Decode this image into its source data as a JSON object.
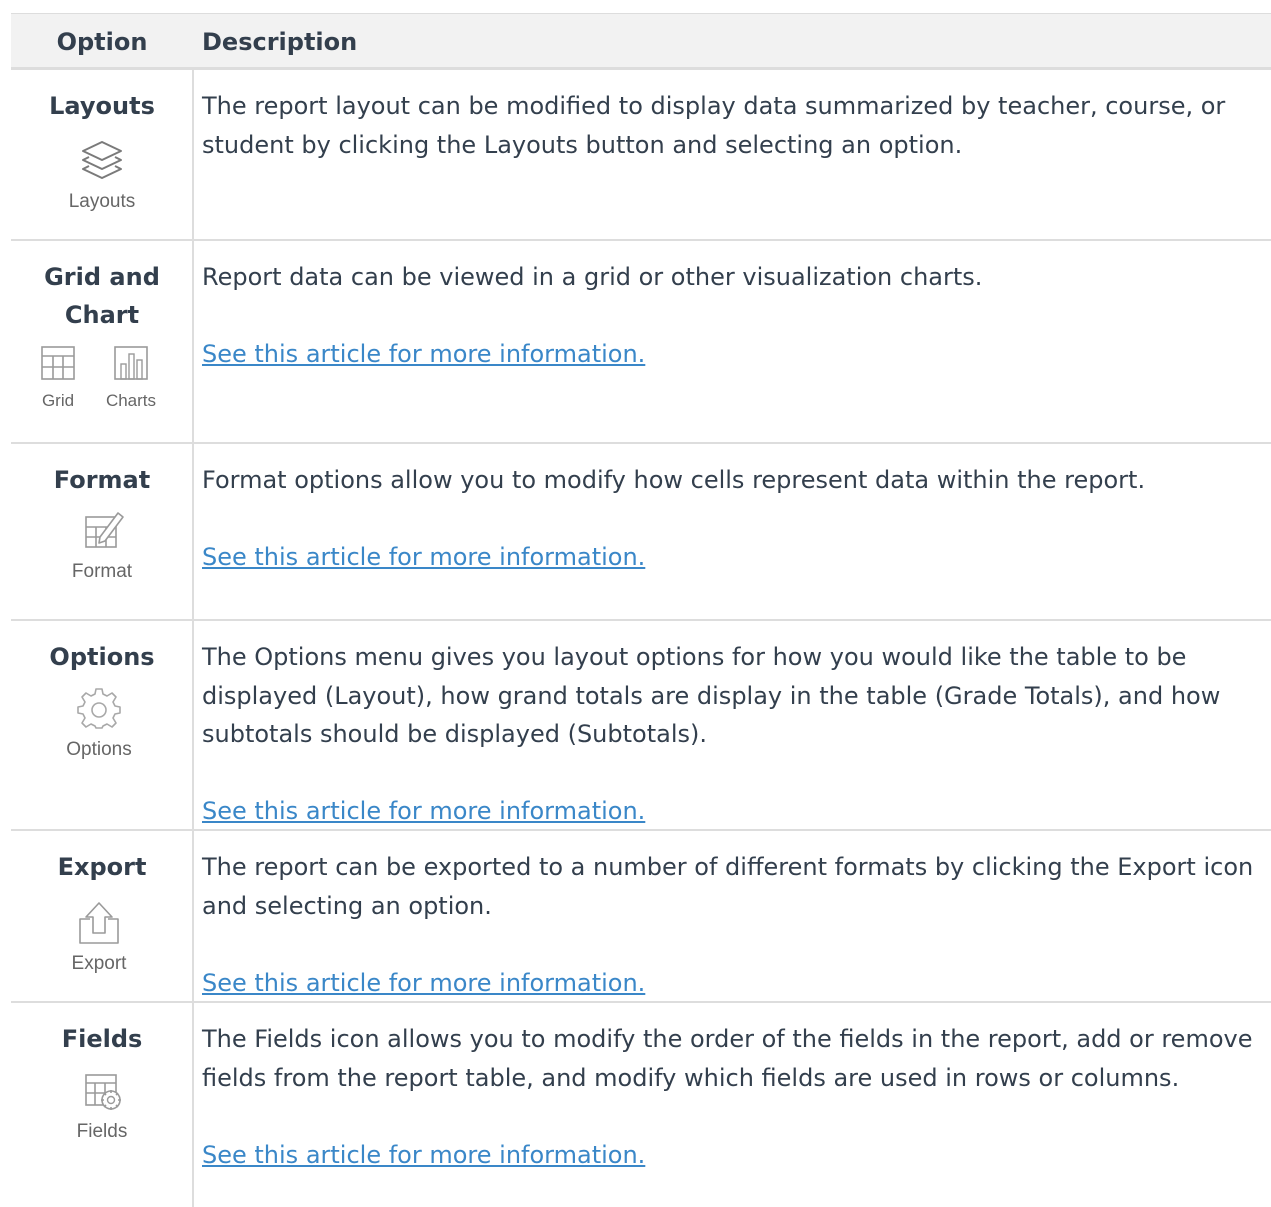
{
  "header": {
    "col_option": "Option",
    "col_description": "Description"
  },
  "rows": [
    {
      "option": "Layouts",
      "icon_label": "Layouts",
      "icon": "layers-icon",
      "description": [
        "The report layout can be modified to display data summarized by teacher, course, or student by clicking the Layouts button and selecting an option."
      ],
      "link": ""
    },
    {
      "option": "Grid and Chart",
      "icons": [
        {
          "icon": "grid-icon",
          "label": "Grid"
        },
        {
          "icon": "bar-chart-icon",
          "label": "Charts"
        }
      ],
      "description": [
        "Report data can be viewed in a grid or other visualization charts."
      ],
      "link": "See this article for more information."
    },
    {
      "option": "Format",
      "icon_label": "Format",
      "icon": "format-table-pencil-icon",
      "description": [
        "Format options allow you to modify how cells represent data within the report."
      ],
      "link": "See this article for more information."
    },
    {
      "option": "Options",
      "icon_label": "Options",
      "icon": "gear-icon",
      "description": [
        "The Options menu gives you layout options for how you would like the table to be displayed (Layout), how grand totals are display in the table (Grade Totals), and how subtotals should be displayed (Subtotals)."
      ],
      "link": "See this article for more information."
    },
    {
      "option": "Export",
      "icon_label": "Export",
      "icon": "export-icon",
      "description": [
        "The report can be exported to a number of different formats by clicking the Export icon and selecting an option."
      ],
      "link": "See this article for more information."
    },
    {
      "option": "Fields",
      "icon_label": "Fields",
      "icon": "fields-table-gear-icon",
      "description": [
        "The Fields icon allows you to modify the order of the fields in the report, add or remove fields from the report table, and modify which fields are used in rows or columns."
      ],
      "link": "See this article for more information."
    }
  ]
}
